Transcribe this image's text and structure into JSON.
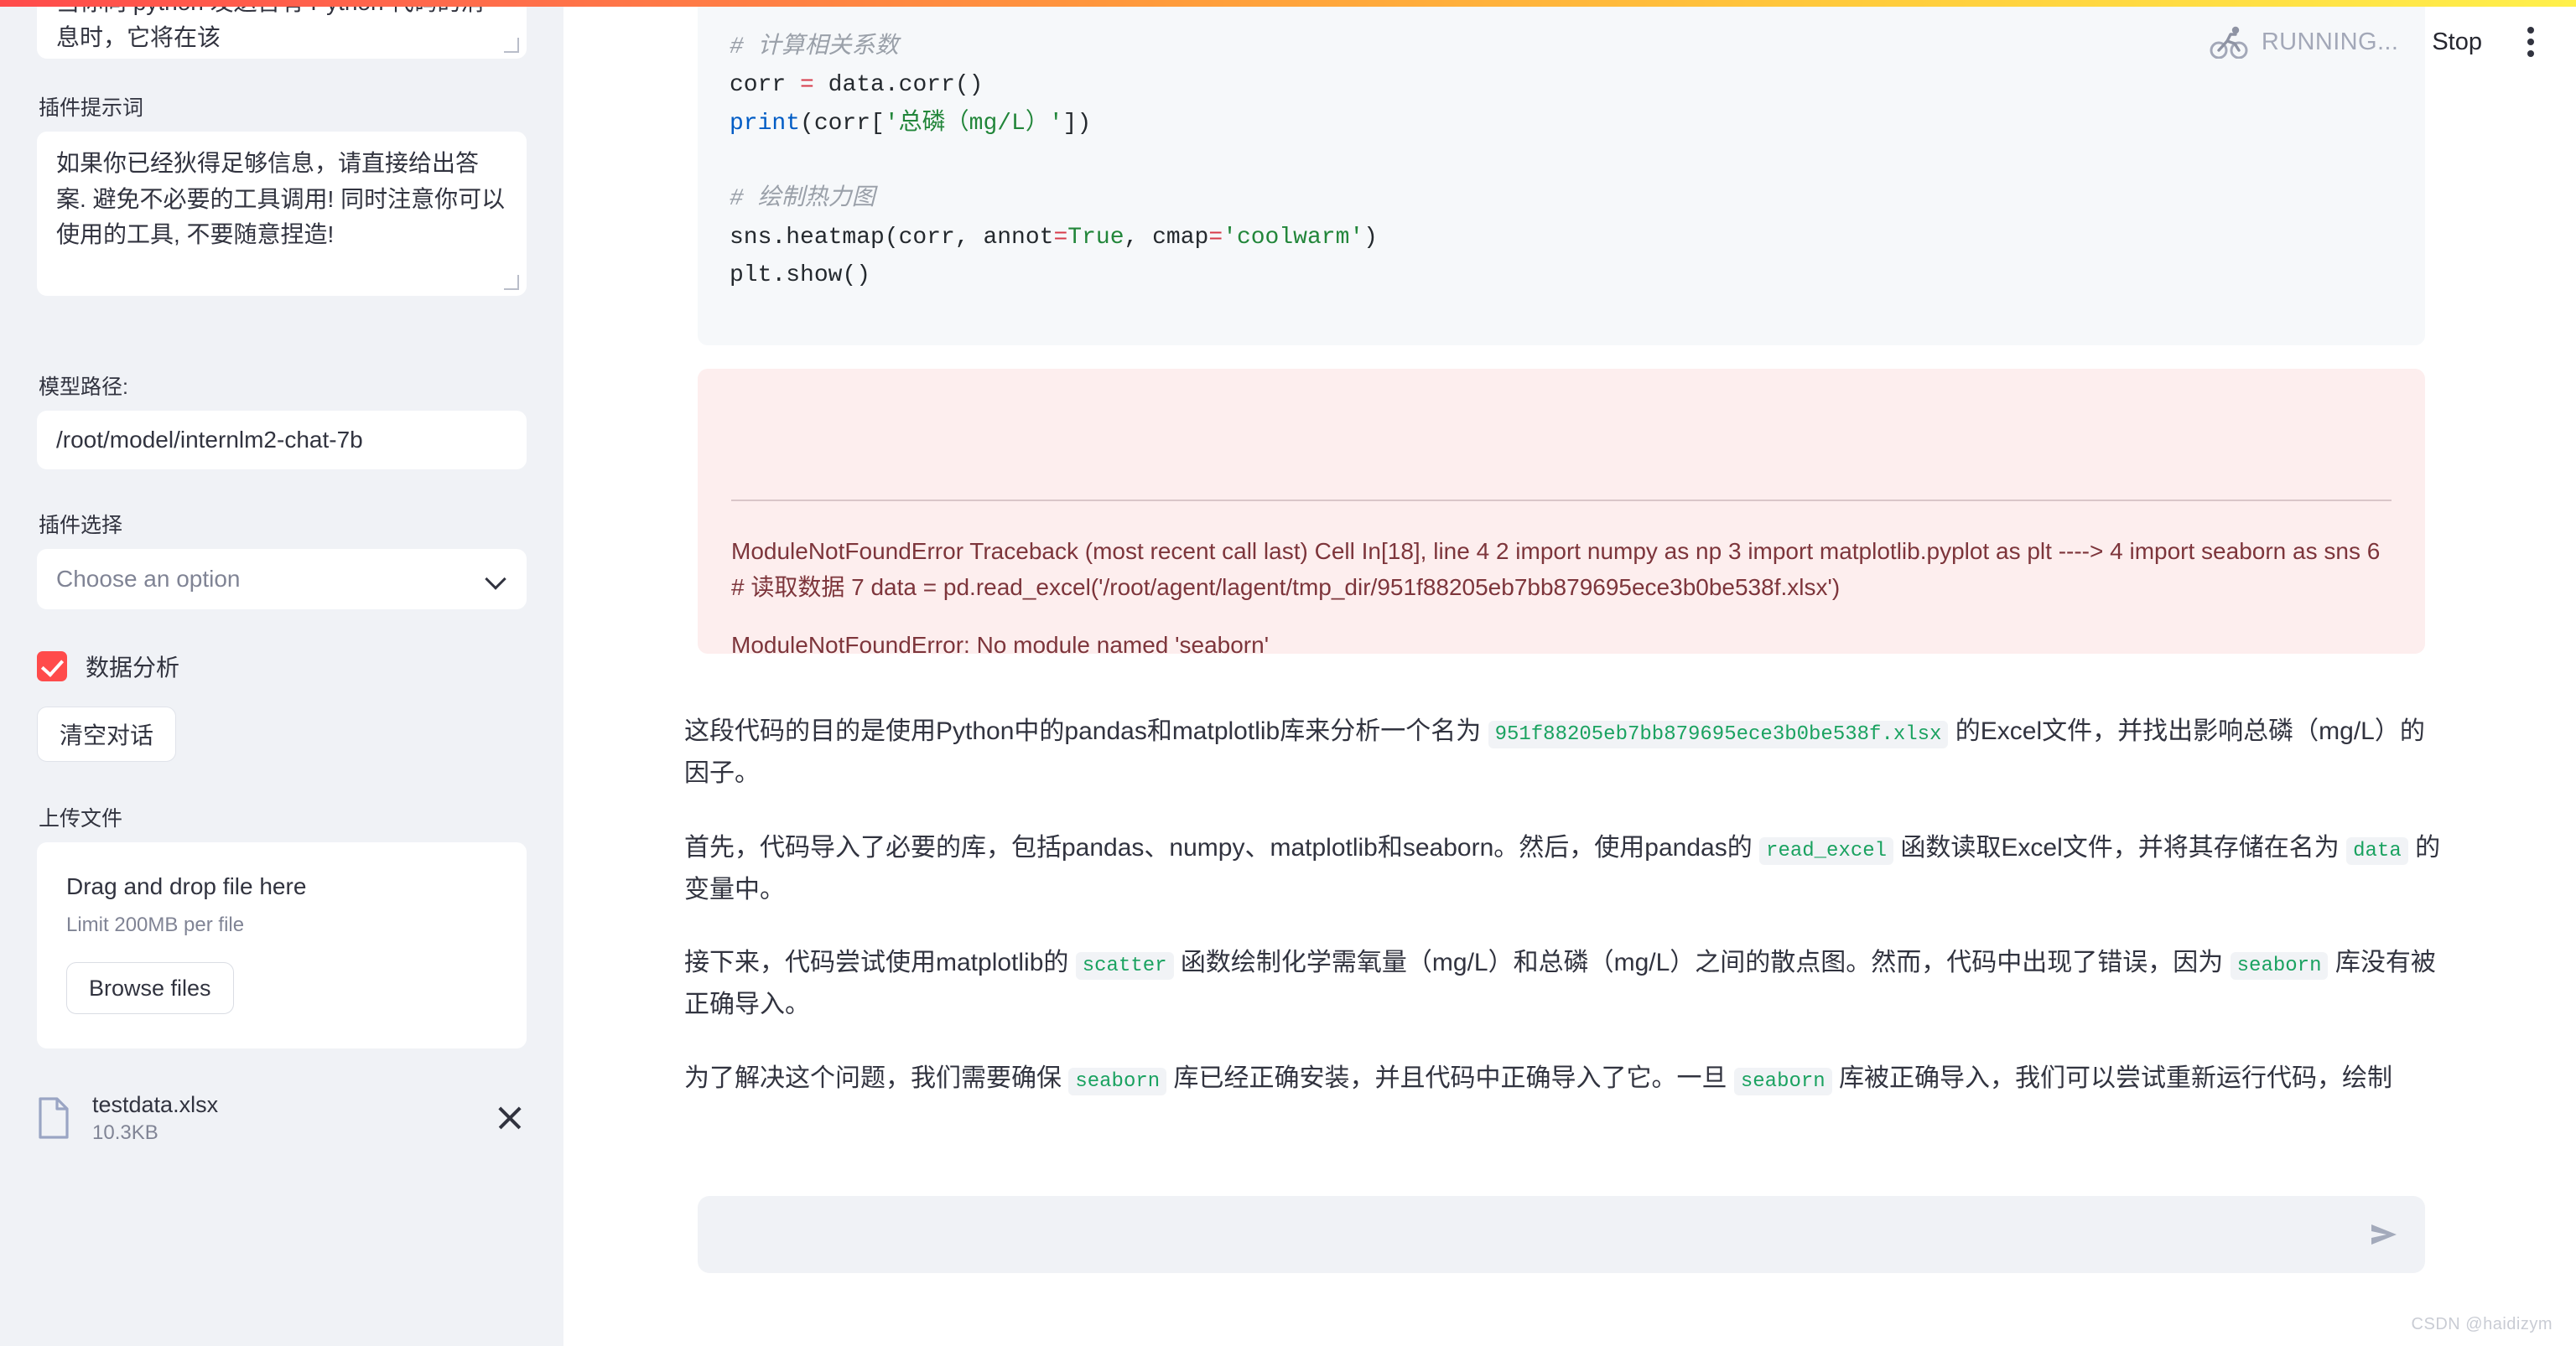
{
  "header": {
    "status_icon": "running-man-icon",
    "status_text": "RUNNING...",
    "stop_label": "Stop",
    "menu_icon": "kebab-menu-icon"
  },
  "sidebar": {
    "system_prompt": {
      "visible_text": "Jupyter 笔记本环境中运行 Python 代码。当你向 python 发送含有 Python 代码的消息时，它将在该"
    },
    "plugin_prompt": {
      "label": "插件提示词",
      "value": "如果你已经狄得足够信息，请直接给出答案. 避免不必要的工具调用! 同时注意你可以使用的工具, 不要随意捏造!"
    },
    "model_path": {
      "label": "模型路径:",
      "value": "/root/model/internlm2-chat-7b"
    },
    "plugin_select": {
      "label": "插件选择",
      "value": "Choose an option",
      "chevron_icon": "chevron-down-icon"
    },
    "checkbox": {
      "label": "数据分析",
      "checked": true,
      "color": "#ff4b4b"
    },
    "clear_button": "清空对话",
    "upload": {
      "label": "上传文件",
      "drop_title": "Drag and drop file here",
      "drop_limit": "Limit 200MB per file",
      "browse_label": "Browse files"
    },
    "uploaded_file": {
      "icon": "file-icon",
      "name": "testdata.xlsx",
      "size": "10.3KB",
      "remove_icon": "close-icon"
    }
  },
  "main": {
    "code_block": {
      "comment_top": "# 计算相关系数",
      "line_corr_var": "corr",
      "line_corr_eq": " = ",
      "line_corr_call": "data.corr()",
      "line_print_fn": "print",
      "line_print_args": "(corr[",
      "line_print_str": "'总磷（mg/L）'",
      "line_print_end": "])",
      "comment_heatmap": "# 绘制热力图",
      "line_heatmap_a": "sns.heatmap(corr, annot",
      "line_heatmap_eq1": "=",
      "line_heatmap_true": "True",
      "line_heatmap_b": ", cmap",
      "line_heatmap_eq2": "=",
      "line_heatmap_cmap": "'coolwarm'",
      "line_heatmap_end": ")",
      "line_show": "plt.show()"
    },
    "error_block": {
      "traceback": "ModuleNotFoundError Traceback (most recent call last) Cell In[18], line 4 2 import numpy as np 3 import matplotlib.pyplot as plt ----> 4 import seaborn as sns 6 # 读取数据 7 data = pd.read_excel('/root/agent/lagent/tmp_dir/951f88205eb7bb879695ece3b0be538f.xlsx')",
      "message": "ModuleNotFoundError: No module named 'seaborn'"
    },
    "paragraphs": {
      "p1_a": "这段代码的目的是使用Python中的pandas和matplotlib库来分析一个名为",
      "p1_code": "951f88205eb7bb879695ece3b0be538f.xlsx",
      "p1_b": "的Excel文件，并找出影响总磷（mg/L）的因子。",
      "p2_a": "首先，代码导入了必要的库，包括pandas、numpy、matplotlib和seaborn。然后，使用pandas的",
      "p2_code": "read_excel",
      "p2_b": "函数读取Excel文件，并将其存储在名为",
      "p2_code2": "data",
      "p2_c": "的变量中。",
      "p3_a": "接下来，代码尝试使用matplotlib的",
      "p3_code": "scatter",
      "p3_b": "函数绘制化学需氧量（mg/L）和总磷（mg/L）之间的散点图。然而，代码中出现了错误，因为",
      "p3_code2": "seaborn",
      "p3_c": "库没有被正确导入。",
      "p4_a": "为了解决这个问题，我们需要确保",
      "p4_code": "seaborn",
      "p4_b": "库已经正确安装，并且代码中正确导入了它。一旦",
      "p4_code2": "seaborn",
      "p4_c": "库被正确导入，我们可以尝试重新运行代码，绘制"
    },
    "chat_input": {
      "value": "",
      "send_icon": "send-icon"
    }
  },
  "watermark": "CSDN @haidizym"
}
